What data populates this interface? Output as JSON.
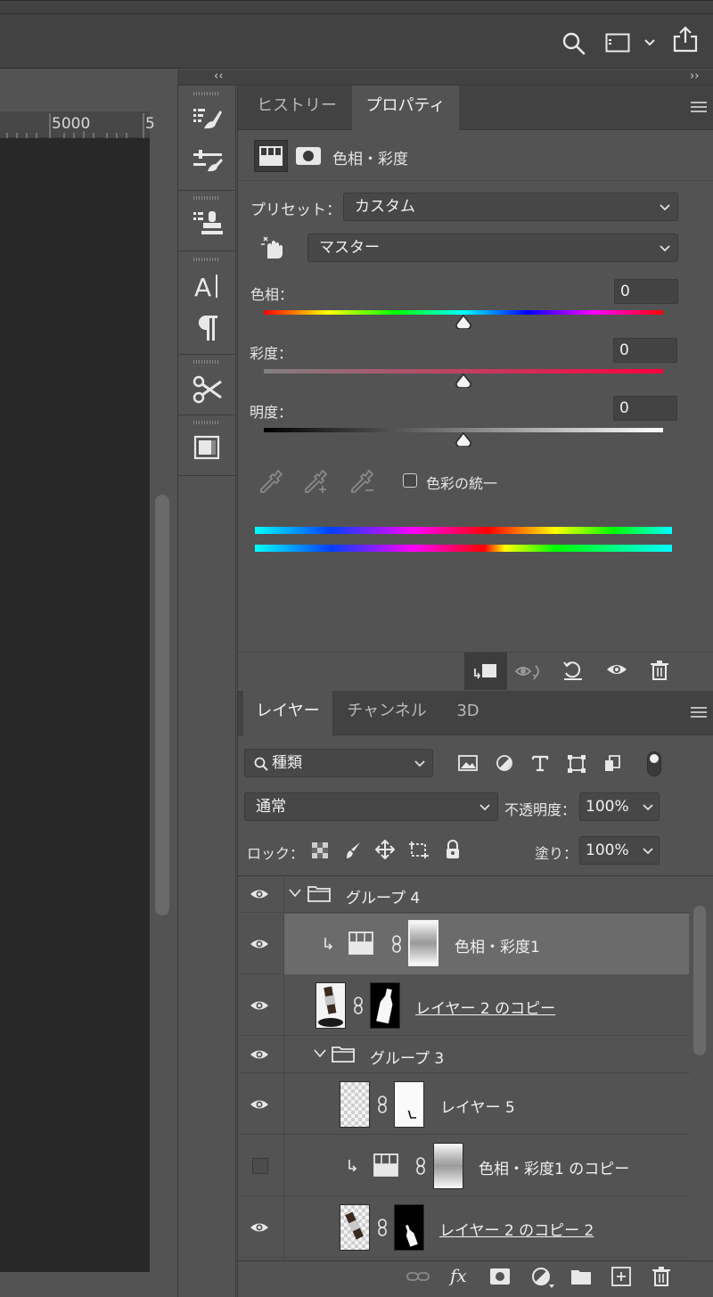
{
  "ruler": {
    "mark": "5000",
    "mark2": "5"
  },
  "collapse_left": "‹‹",
  "collapse_right": "››",
  "properties_panel": {
    "tabs": [
      {
        "label": "ヒストリー",
        "active": false
      },
      {
        "label": "プロパティ",
        "active": true
      }
    ],
    "adjustment_title": "色相・彩度",
    "preset_label": "プリセット：",
    "preset_value": "カスタム",
    "channel_value": "マスター",
    "hue": {
      "label": "色相：",
      "value": "0"
    },
    "saturation": {
      "label": "彩度：",
      "value": "0"
    },
    "lightness": {
      "label": "明度：",
      "value": "0"
    },
    "colorize_label": "色彩の統一",
    "colorize_checked": false
  },
  "layers_panel": {
    "tabs": [
      {
        "label": "レイヤー",
        "active": true
      },
      {
        "label": "チャンネル",
        "active": false
      },
      {
        "label": "3D",
        "active": false
      }
    ],
    "filter_value": "種類",
    "blend_mode": "通常",
    "opacity_label": "不透明度：",
    "opacity_value": "100%",
    "lock_label": "ロック：",
    "fill_label": "塗り：",
    "fill_value": "100%",
    "layers": [
      {
        "name": "グループ 4",
        "kind": "group",
        "visible": true
      },
      {
        "name": "色相・彩度1",
        "kind": "adjustment",
        "visible": true,
        "selected": true
      },
      {
        "name": "レイヤー 2 のコピー",
        "kind": "smart",
        "visible": true
      },
      {
        "name": "グループ 3",
        "kind": "group",
        "visible": true
      },
      {
        "name": "レイヤー 5",
        "kind": "pixel",
        "visible": true
      },
      {
        "name": "色相・彩度1 のコピー",
        "kind": "adjustment",
        "visible": false
      },
      {
        "name": "レイヤー 2 のコピー 2",
        "kind": "smart",
        "visible": true
      }
    ],
    "fx_label": "fx"
  }
}
